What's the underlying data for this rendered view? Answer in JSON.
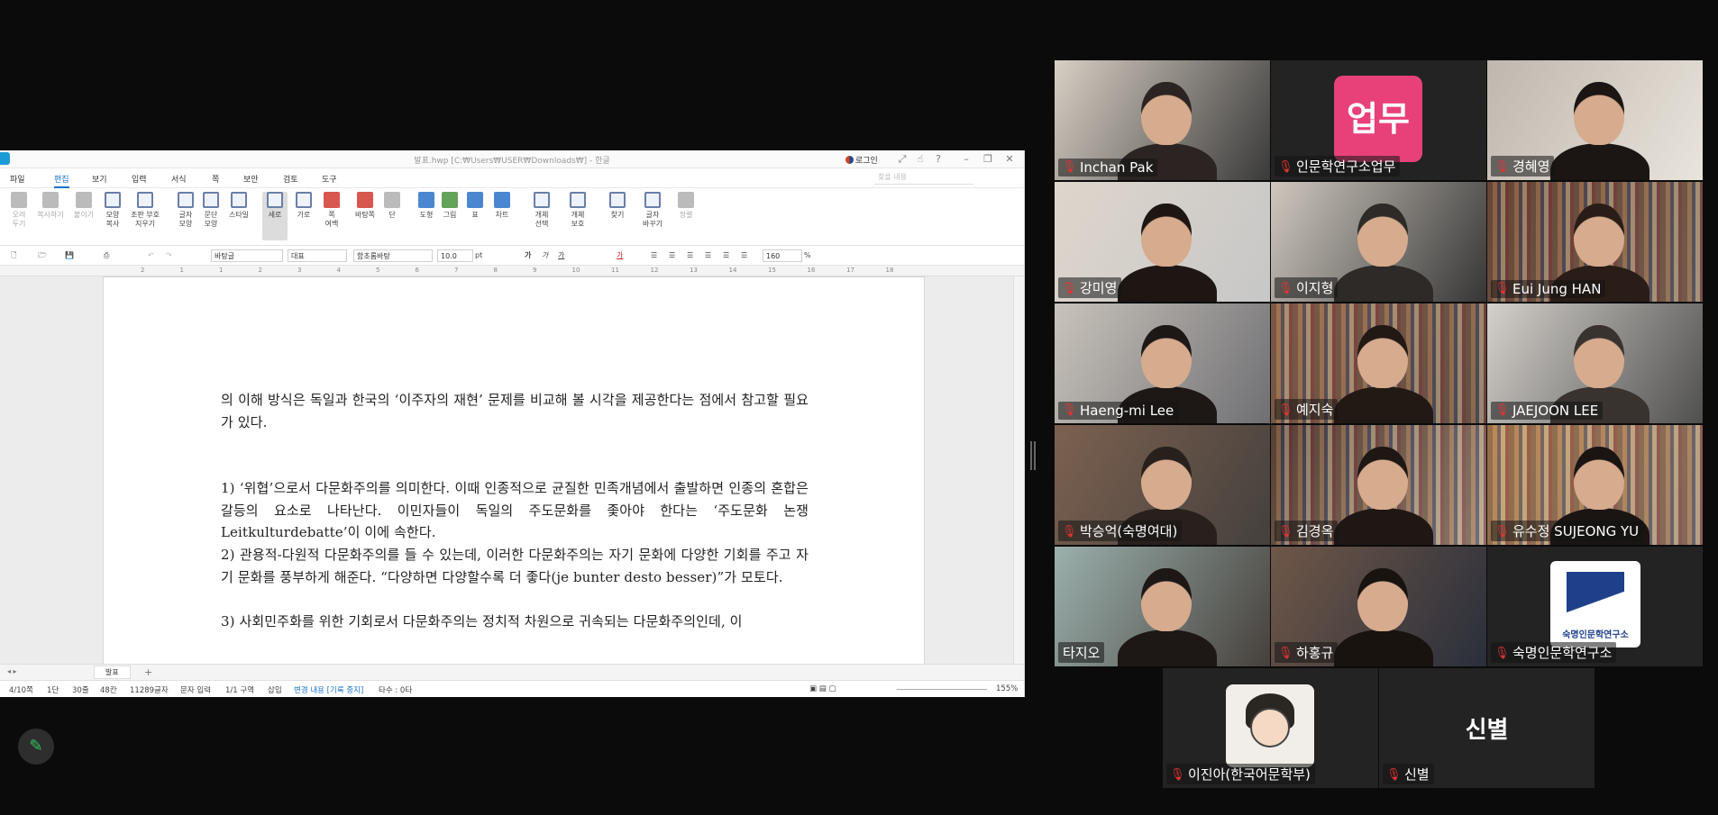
{
  "hwp": {
    "title": "발표.hwp [C:₩Users₩USER₩Downloads₩] - 한글",
    "login": "로그인",
    "menu": [
      "파일",
      "편집",
      "보기",
      "입력",
      "서식",
      "쪽",
      "보안",
      "검토",
      "도구"
    ],
    "active_menu": "편집",
    "search_placeholder": "찾을 내용",
    "ribbon": [
      {
        "label": "오려\n두기",
        "icon": "scissors-icon"
      },
      {
        "label": "복사하기",
        "icon": "copy-icon"
      },
      {
        "label": "붙이기",
        "icon": "paste-icon"
      },
      {
        "label": "모양\n복사",
        "icon": "format-copy-icon"
      },
      {
        "label": "조판 부호\n지우기",
        "icon": "clear-format-icon"
      },
      {
        "label": "글자\n모양",
        "icon": "char-shape-icon"
      },
      {
        "label": "문단\n모양",
        "icon": "para-shape-icon"
      },
      {
        "label": "스타일",
        "icon": "style-icon"
      },
      {
        "label": "세로",
        "icon": "portrait-icon"
      },
      {
        "label": "가로",
        "icon": "landscape-icon"
      },
      {
        "label": "쪽\n여백",
        "icon": "margin-icon"
      },
      {
        "label": "바탕쪽",
        "icon": "master-page-icon"
      },
      {
        "label": "단",
        "icon": "column-icon"
      },
      {
        "label": "도형",
        "icon": "shape-icon"
      },
      {
        "label": "그림",
        "icon": "picture-icon"
      },
      {
        "label": "표",
        "icon": "table-icon"
      },
      {
        "label": "차트",
        "icon": "chart-icon"
      },
      {
        "label": "개체\n선택",
        "icon": "object-select-icon"
      },
      {
        "label": "개체\n보호",
        "icon": "object-protect-icon"
      },
      {
        "label": "찾기",
        "icon": "find-icon"
      },
      {
        "label": "글자\n바꾸기",
        "icon": "replace-icon"
      },
      {
        "label": "정렬",
        "icon": "sort-icon"
      }
    ],
    "toolbar2": {
      "style": "바탕글",
      "lang": "대표",
      "font": "함초롬바탕",
      "size": "10.0",
      "size_unit": "pt",
      "zoom": "160",
      "zoom_unit": "%"
    },
    "ruler_numbers": [
      "2",
      "1",
      "1",
      "2",
      "3",
      "4",
      "5",
      "6",
      "7",
      "8",
      "9",
      "10",
      "11",
      "12",
      "13",
      "14",
      "15",
      "16",
      "17",
      "18"
    ],
    "paragraphs": [
      "의 이해 방식은 독일과 한국의 ‘이주자의 재현’ 문제를 비교해 볼 시각을 제공한다는 점에서 참고할 필요가 있다.",
      "1) ‘위협’으로서 다문화주의를 의미한다. 이때 인종적으로 균질한 민족개념에서 출발하면 인종의 혼합은 갈등의 요소로 나타난다. 이민자들이 독일의 주도문화를 좇아야 한다는 ‘주도문화 논쟁Leitkulturdebatte’이 이에 속한다.",
      "2) 관용적-다원적 다문화주의를 들 수 있는데, 이러한 다문화주의는 자기 문화에 다양한 기회를 주고 자기 문화를 풍부하게 해준다. “다양하면 다양할수록 더 좋다(je bunter desto besser)”가 모토다.",
      "3) 사회민주화를 위한 기회로서 다문화주의는 정치적 차원으로 귀속되는 다문화주의인데, 이"
    ],
    "sheet_tab": "발표",
    "status": {
      "page": "4/10쪽",
      "section": "1단",
      "line": "30줄",
      "col": "48칸",
      "chars": "11289글자",
      "mode": "문자 입력",
      "area": "1/1 구역",
      "insert": "삽입",
      "track": "변경 내용 [기록 중지]",
      "count": "타수 : 0타",
      "zoom": "155%"
    }
  },
  "participants": [
    {
      "name": "Inchan Pak",
      "muted": true
    },
    {
      "name": "인문학연구소업무",
      "muted": true,
      "avatar_text": "업무",
      "avatar_color": "#e8417a"
    },
    {
      "name": "경혜영",
      "muted": true
    },
    {
      "name": "강미영",
      "muted": true
    },
    {
      "name": "이지형",
      "muted": true
    },
    {
      "name": "Eui Jung HAN",
      "muted": true
    },
    {
      "name": "Haeng-mi Lee",
      "muted": true
    },
    {
      "name": "예지숙",
      "muted": true
    },
    {
      "name": "JAEJOON LEE",
      "muted": true
    },
    {
      "name": "박승억(숙명여대)",
      "muted": true
    },
    {
      "name": "김경옥",
      "muted": true
    },
    {
      "name": "유수정 SUJEONG YU",
      "muted": true
    },
    {
      "name": "타지오",
      "muted": false,
      "speaking": true
    },
    {
      "name": "하홍규",
      "muted": true
    },
    {
      "name": "숙명인문학연구소",
      "muted": true,
      "logo_text": "숙명인문학연구소"
    },
    {
      "name": "이진아(한국어문학부)",
      "muted": true
    },
    {
      "name": "신별",
      "muted": true,
      "avatar_text": "신별"
    }
  ],
  "colors": {
    "speaker_border": "#2fc55c",
    "muted_icon": "#e33333",
    "accent": "#1a73c8"
  }
}
